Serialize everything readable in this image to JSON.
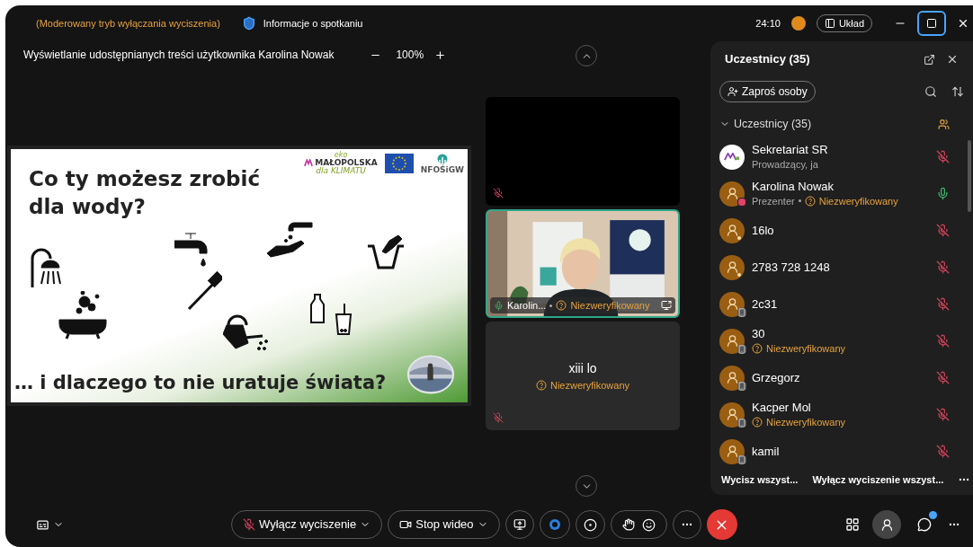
{
  "top_bar": {
    "mode_notice": "(Moderowany tryb wyłączania wyciszenia)",
    "info": "Informacje o spotkaniu",
    "timer": "24:10",
    "layout_button": "Układ",
    "maximized": true
  },
  "share_bar": {
    "title": "Wyświetlanie udostępnianych treści użytkownika Karolina Nowak",
    "zoom": "100%"
  },
  "slide": {
    "title_lines": [
      "Co ty możesz zrobić",
      "dla wody?"
    ],
    "footer": "… i dlaczego to nie uratuje świata?",
    "logo_eko": "eko",
    "logo_region": "MAŁOPOLSKA",
    "logo_climate": "dla KLIMATU",
    "logo_fund": "NFOŚiGW"
  },
  "gallery": [
    {
      "kind": "empty",
      "muted": true,
      "speaking": false
    },
    {
      "kind": "video",
      "name": "Karolin...",
      "status": "Niezweryfikowany",
      "muted": false,
      "speaking": true
    },
    {
      "kind": "name",
      "name": "xiii lo",
      "status": "Niezweryfikowany",
      "muted": true,
      "speaking": false
    }
  ],
  "participants": {
    "title": "Uczestnicy (35)",
    "invite": "Zaproś osoby",
    "group": "Uczestnicy (35)",
    "expanded": true,
    "members": [
      {
        "name": "Sekretariat SR",
        "role": "Prowadzący, ja",
        "kind": "logo",
        "muted": true
      },
      {
        "name": "Karolina Nowak",
        "role": "Prezenter",
        "status": "Niezweryfikowany",
        "kind": "presenter",
        "muted": false
      },
      {
        "name": "16lo",
        "kind": "guest",
        "muted": true
      },
      {
        "name": "2783 728 1248",
        "kind": "guest",
        "muted": true
      },
      {
        "name": "2c31",
        "kind": "phone",
        "muted": true
      },
      {
        "name": "30",
        "status": "Niezweryfikowany",
        "kind": "phone",
        "muted": true
      },
      {
        "name": "Grzegorz",
        "kind": "phone",
        "muted": true
      },
      {
        "name": "Kacper Mol",
        "status": "Niezweryfikowany",
        "kind": "phone",
        "muted": true
      },
      {
        "name": "kamil",
        "kind": "phone",
        "muted": true
      }
    ],
    "footer": [
      "Wycisz wszyst...",
      "Wyłącz wyciszenie wszyst..."
    ]
  },
  "toolbar": {
    "unmute": "Wyłącz wyciszenie",
    "video": "Stop wideo",
    "participants_open": true,
    "chat_unread": true
  }
}
